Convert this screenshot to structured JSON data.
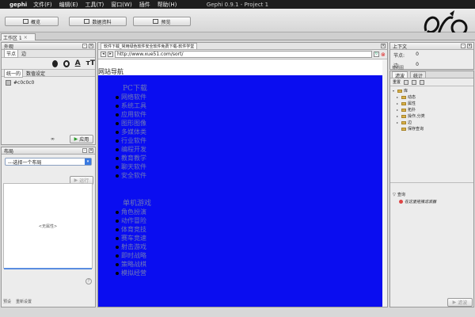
{
  "menubar": {
    "app_name": "gephi",
    "items": [
      "文件(F)",
      "编辑(E)",
      "工具(T)",
      "窗口(W)",
      "插件",
      "帮助(H)"
    ],
    "window_title": "Gephi 0.9.1 - Project 1"
  },
  "toolbar": {
    "overview": "概览",
    "data_lab": "数据资料",
    "preview": "预览"
  },
  "workspace": {
    "tab": "工作区 1",
    "close": "×"
  },
  "partition": {
    "title": "外观",
    "node_tab": "节点",
    "edge_tab": "边",
    "unique_tab": "统一的",
    "ranking_tab": "数值设定",
    "size_glyph": "A",
    "label_glyph": "тT",
    "color_value": "#c0c0c0",
    "apply": "应用"
  },
  "layout": {
    "title": "布局",
    "select_placeholder": "---选择一个布局",
    "run": "运行",
    "no_props": "<无属性>",
    "links": [
      "预设",
      "重新设置"
    ]
  },
  "browser": {
    "tab": "软件下载_常用绿色软件安全软件免费下载-软件学堂",
    "url": "http://www.xue51.com/sort/",
    "site_nav": "网站导航",
    "sections": [
      {
        "heading": "PC下载",
        "items": [
          "网络软件",
          "系统工具",
          "应用软件",
          "图形图像",
          "多媒体类",
          "行业软件",
          "编程开发",
          "教育教学",
          "聊天软件",
          "安全软件"
        ]
      },
      {
        "heading": "单机游戏",
        "items": [
          "角色扮演",
          "动作冒险",
          "体育竞技",
          "赛车竞速",
          "射击游戏",
          "即时战略",
          "策略战棋",
          "模拟经营"
        ]
      }
    ]
  },
  "context": {
    "title": "上下文",
    "nodes_label": "节点:",
    "nodes_value": "0",
    "edges_label": "边:",
    "edges_value": "0",
    "history": "有向图"
  },
  "filters": {
    "tab_filter": "滤波",
    "tab_stats": "统计",
    "reset": "重置",
    "library": "库",
    "tree": [
      "动态",
      "属性",
      "拓扑",
      "操作,分类",
      "边",
      "保存查询"
    ],
    "query_label": "查询",
    "query_hint": "在这里拖拽滤波器",
    "filter_button": "滤波"
  }
}
